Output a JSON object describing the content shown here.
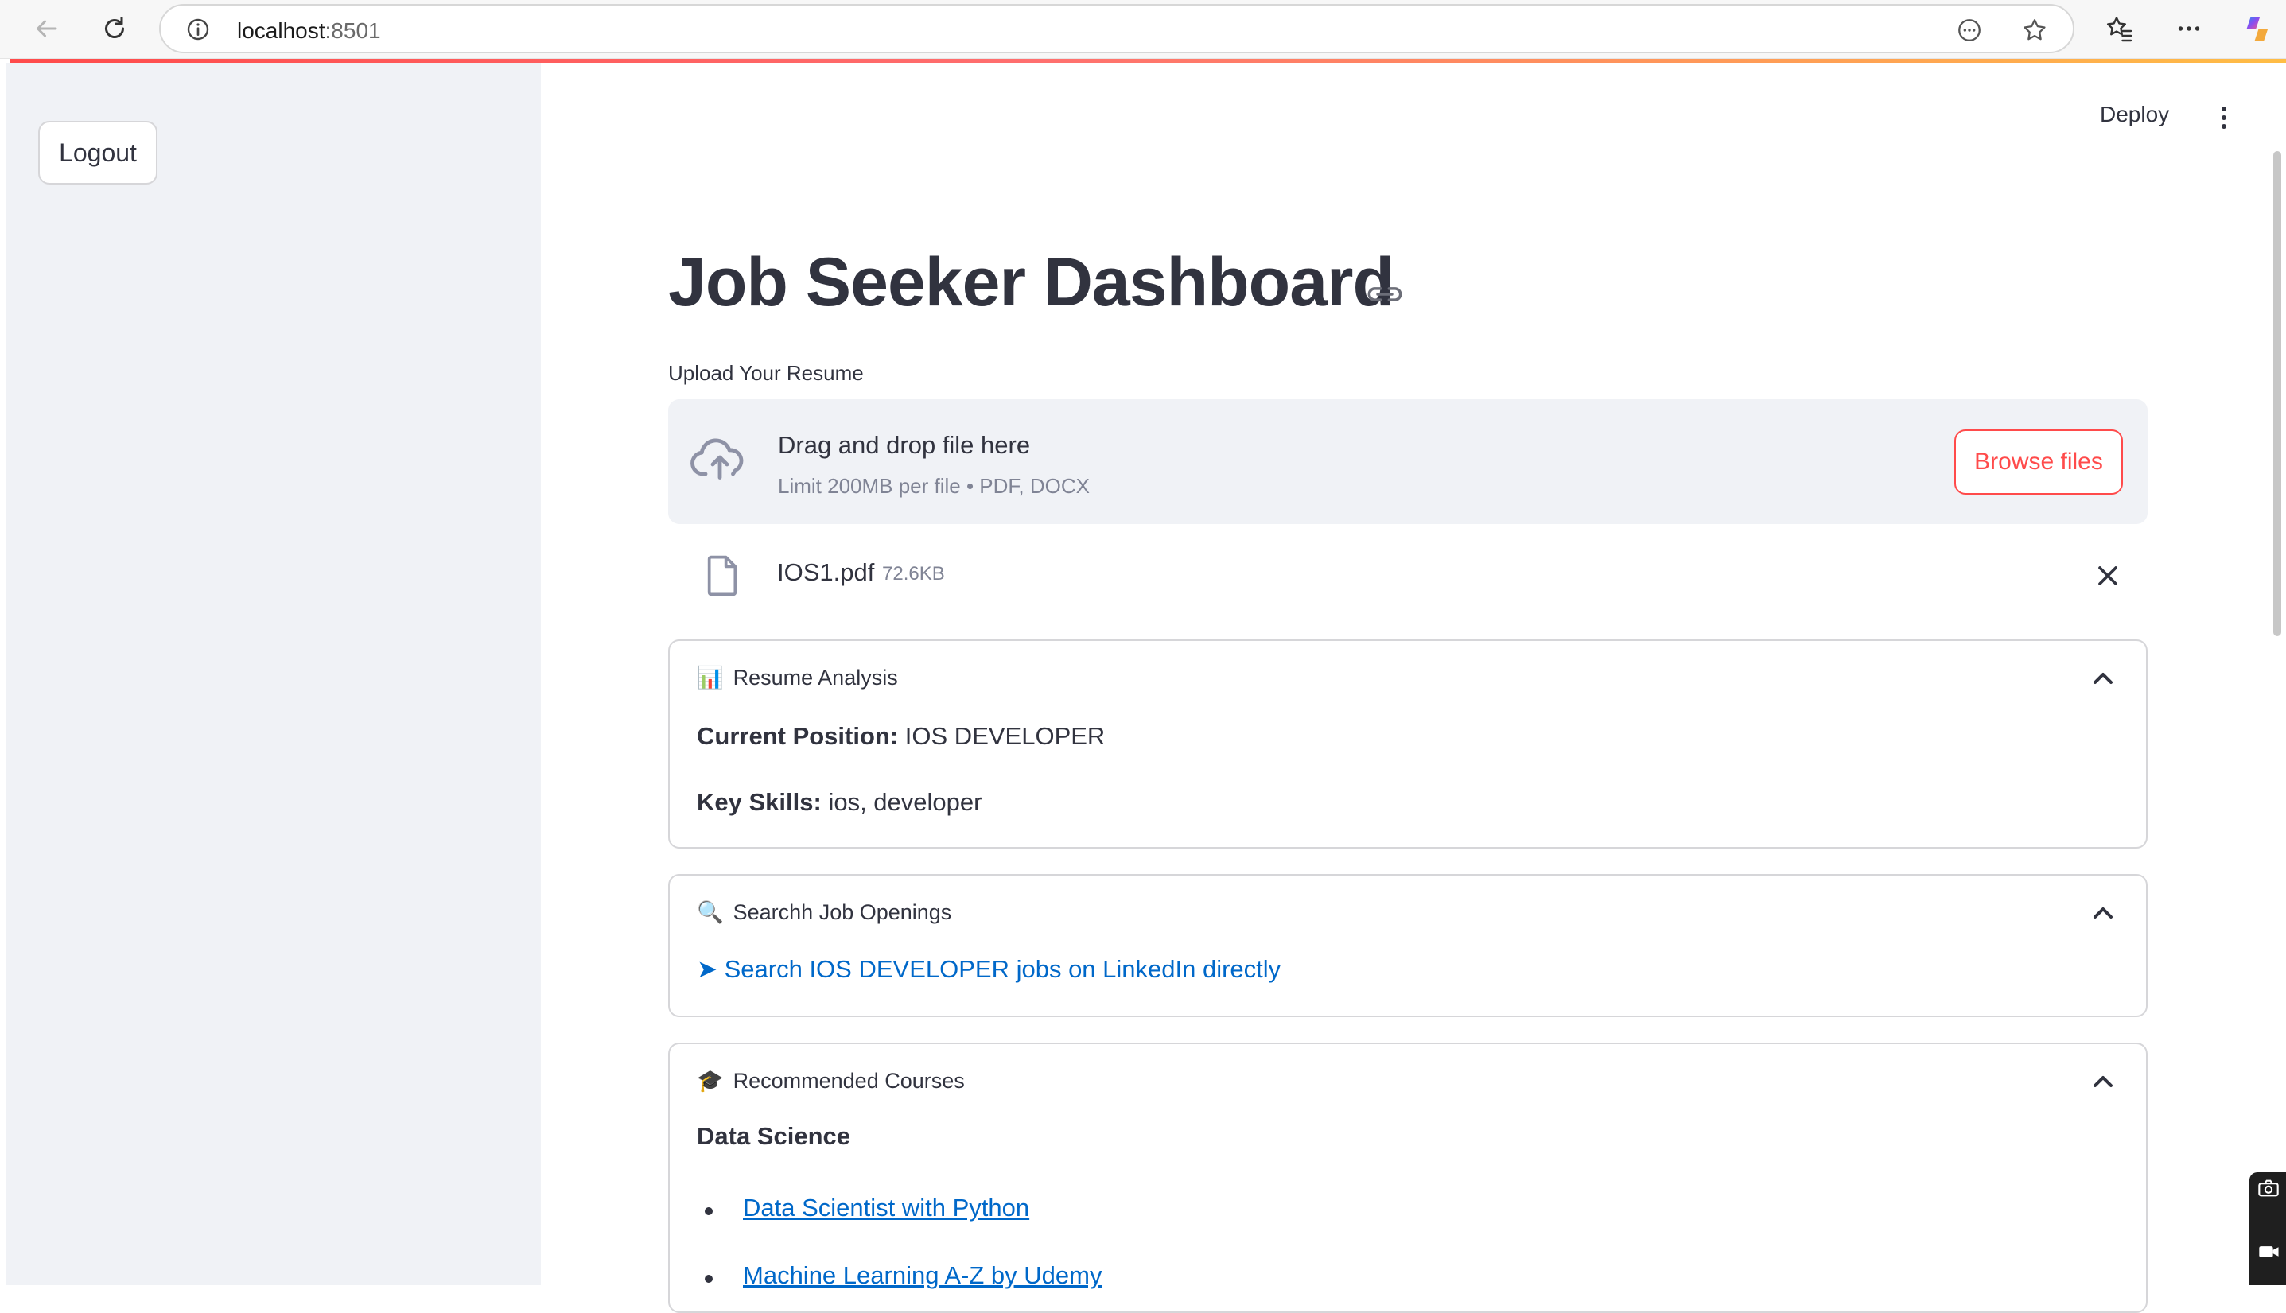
{
  "browser": {
    "url_host": "localhost",
    "url_port": ":8501",
    "icons": [
      "back-arrow-icon",
      "refresh-icon",
      "info-icon",
      "reader-icon",
      "star-icon",
      "favorites-icon",
      "more-icon",
      "copilot-icon"
    ]
  },
  "sidebar": {
    "logout_label": "Logout"
  },
  "header": {
    "deploy_label": "Deploy"
  },
  "main": {
    "title": "Job Seeker Dashboard",
    "upload_label": "Upload Your Resume",
    "dropzone": {
      "main_text": "Drag and drop file here",
      "sub_text": "Limit 200MB per file • PDF, DOCX",
      "browse_label": "Browse files"
    },
    "file": {
      "name": "IOS1.pdf",
      "size": "72.6KB"
    },
    "resume_analysis": {
      "emoji": "📊",
      "title": "Resume Analysis",
      "position_label": "Current Position:",
      "position_value": "IOS DEVELOPER",
      "skills_label": "Key Skills:",
      "skills_value": "ios, developer"
    },
    "job_openings": {
      "emoji": "🔍",
      "title": "Searchh Job Openings",
      "link_arrow": "➤",
      "link_text": "Search IOS DEVELOPER jobs on LinkedIn directly"
    },
    "courses": {
      "emoji": "🎓",
      "title": "Recommended Courses",
      "category": "Data Science",
      "items": [
        "Data Scientist with Python",
        "Machine Learning A-Z by Udemy"
      ]
    }
  },
  "colors": {
    "accent": "#ff4b4b",
    "link": "#0068c9",
    "text": "#31333f",
    "muted": "#808495",
    "sidebar_bg": "#f0f2f6"
  }
}
